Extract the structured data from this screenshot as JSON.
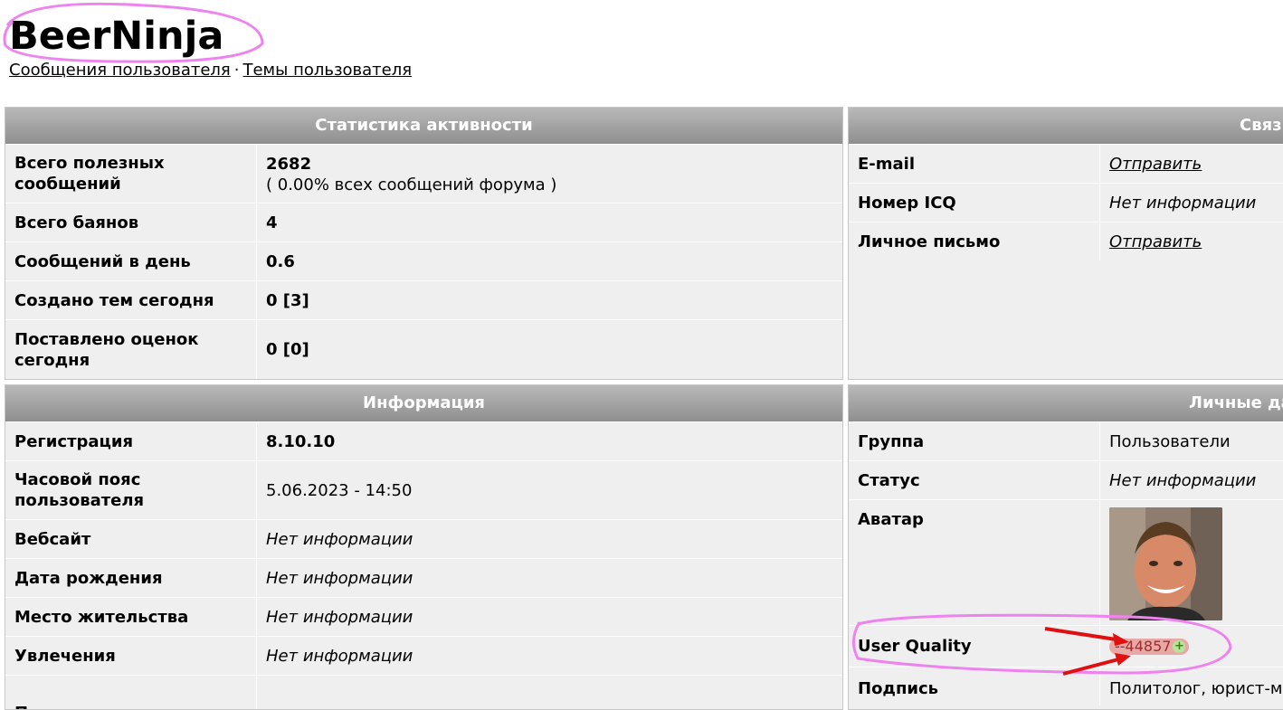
{
  "user": {
    "name": "BeerNinja"
  },
  "nav": {
    "messages": "Сообщения пользователя",
    "separator": "·",
    "topics": "Темы пользователя"
  },
  "activity": {
    "header": "Статистика активности",
    "rows": [
      {
        "label": "Всего полезных сообщений",
        "value": "2682",
        "sub": "( 0.00% всех сообщений форума )"
      },
      {
        "label": "Всего баянов",
        "value": "4"
      },
      {
        "label": "Сообщений в день",
        "value": "0.6"
      },
      {
        "label": "Создано тем сегодня",
        "value": "0 [3]"
      },
      {
        "label": "Поставлено оценок сегодня",
        "value": "0 [0]"
      }
    ]
  },
  "contacts": {
    "header": "Связь",
    "rows": [
      {
        "label": "E-mail",
        "value": "Отправить"
      },
      {
        "label": "Номер ICQ",
        "value": "Нет информации"
      },
      {
        "label": "Личное письмо",
        "value": "Отправить"
      }
    ]
  },
  "info": {
    "header": "Информация",
    "rows": [
      {
        "label": "Регистрация",
        "value": "8.10.10"
      },
      {
        "label": "Часовой пояс пользователя",
        "value": "5.06.2023 - 14:50"
      },
      {
        "label": "Вебсайт",
        "value": "Нет информации"
      },
      {
        "label": "Дата рождения",
        "value": "Нет информации"
      },
      {
        "label": "Место жительства",
        "value": "Нет информации"
      },
      {
        "label": "Увлечения",
        "value": "Нет информации"
      },
      {
        "label": "Половая",
        "value": ""
      }
    ]
  },
  "personal": {
    "header": "Личные данные",
    "rows": [
      {
        "label": "Группа",
        "value": "Пользователи"
      },
      {
        "label": "Статус",
        "value": "Нет информации"
      },
      {
        "label": "Аватар",
        "value": ""
      },
      {
        "label": "User Quality",
        "value": "--44857"
      },
      {
        "label": "Подпись",
        "value": "Политолог, юрист-международник"
      }
    ]
  },
  "icons": {
    "plus": "+",
    "plus_icon": "plus-circle-icon",
    "avatar": "user-photo"
  },
  "colors": {
    "header_gradient_top": "#b9b9b9",
    "header_gradient_bottom": "#8f8f8f",
    "panel_bg": "#efefef",
    "annotation": "#ee82ee",
    "arrow": "#e01010"
  }
}
